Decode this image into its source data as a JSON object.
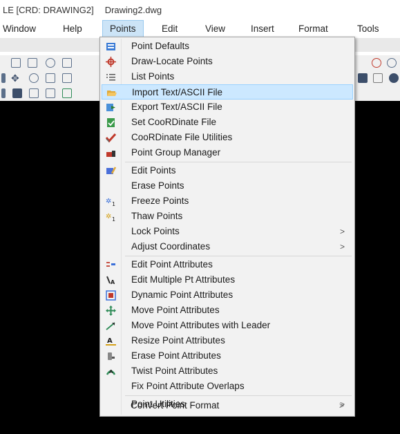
{
  "window": {
    "title_left": "LE [CRD: DRAWING2]",
    "title_file": "Drawing2.dwg"
  },
  "menubar": {
    "items": [
      "Window",
      "Help",
      "Points",
      "Edit",
      "View",
      "Insert",
      "Format",
      "Tools"
    ],
    "active": "Points"
  },
  "points_menu": {
    "items": [
      {
        "label": "Point Defaults",
        "icon": "point-defaults-icon"
      },
      {
        "label": "Draw-Locate Points",
        "icon": "draw-locate-icon"
      },
      {
        "label": "List Points",
        "icon": "list-points-icon"
      },
      {
        "label": "Import Text/ASCII File",
        "icon": "folder-open-icon",
        "highlighted": true
      },
      {
        "label": "Export Text/ASCII File",
        "icon": "export-icon"
      },
      {
        "label": "Set CooRDinate File",
        "icon": "set-file-icon"
      },
      {
        "label": "CooRDinate File Utilities",
        "icon": "checkmark-icon"
      },
      {
        "label": "Point Group Manager",
        "icon": "group-manager-icon"
      },
      {
        "label": "Edit Points",
        "icon": "edit-points-icon"
      },
      {
        "label": "Erase Points"
      },
      {
        "label": "Freeze Points",
        "icon": "freeze-icon"
      },
      {
        "label": "Thaw Points",
        "icon": "thaw-icon"
      },
      {
        "label": "Lock Points",
        "submenu": true
      },
      {
        "label": "Adjust Coordinates",
        "submenu": true
      },
      {
        "label": "Edit Point Attributes",
        "icon": "edit-attributes-icon"
      },
      {
        "label": "Edit Multiple Pt Attributes",
        "icon": "edit-multiple-icon"
      },
      {
        "label": "Dynamic Point Attributes",
        "icon": "dynamic-attributes-icon"
      },
      {
        "label": "Move Point Attributes",
        "icon": "move-icon"
      },
      {
        "label": "Move Point Attributes with Leader",
        "icon": "leader-icon"
      },
      {
        "label": "Resize Point Attributes",
        "icon": "resize-icon"
      },
      {
        "label": "Erase Point Attributes",
        "icon": "erase-attributes-icon"
      },
      {
        "label": "Twist Point Attributes",
        "icon": "twist-icon"
      },
      {
        "label": "Fix Point Attribute Overlaps"
      },
      {
        "label": "Point Utilities",
        "submenu": true
      },
      {
        "label": "Convert Point Format",
        "submenu": true
      }
    ],
    "submenu_arrow": ">"
  },
  "colors": {
    "highlight": "#cce8ff",
    "menu_bg": "#f2f2f2",
    "canvas": "#000000"
  }
}
